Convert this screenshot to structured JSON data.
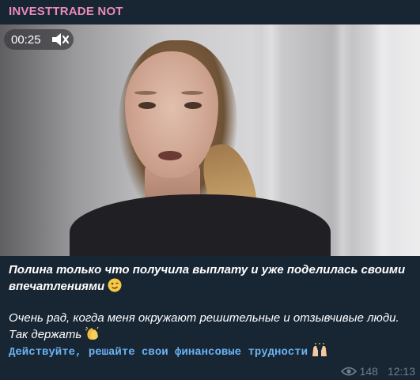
{
  "channel": {
    "name": "INVESTTRADE NOT",
    "name_color": "#e88cb8"
  },
  "video": {
    "duration": "00:25",
    "mute_icon": "speaker-muted-icon"
  },
  "caption": {
    "line1": "Полина только что получила выплату и уже поделилась своими впечатлениями",
    "line1_emoji": "winking-face-emoji",
    "line2": "Очень рад, когда меня окружают решительные и отзывчивые люди. Так держать",
    "line2_emoji": "clapping-hands-emoji",
    "line3": "Действуйте, решайте свои финансовые трудности",
    "line3_emoji": "raising-hands-emoji",
    "link_color": "#6ab3f3"
  },
  "meta": {
    "views": "148",
    "time": "12:13",
    "views_icon": "eye-icon"
  },
  "colors": {
    "background": "#182533",
    "meta_text": "#6d7f8f"
  }
}
